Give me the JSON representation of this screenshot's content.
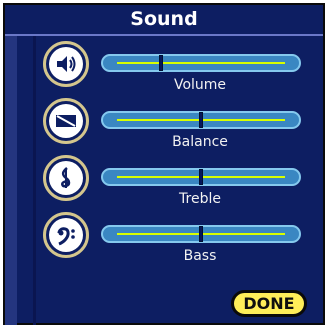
{
  "window": {
    "title": "Sound"
  },
  "controls": [
    {
      "id": "volume",
      "label": "Volume",
      "icon": "speaker-icon",
      "value": 0.26
    },
    {
      "id": "balance",
      "label": "Balance",
      "icon": "balance-icon",
      "value": 0.5
    },
    {
      "id": "treble",
      "label": "Treble",
      "icon": "treble-clef-icon",
      "value": 0.5
    },
    {
      "id": "bass",
      "label": "Bass",
      "icon": "bass-clef-icon",
      "value": 0.5
    }
  ],
  "footer": {
    "done_label": "DONE"
  },
  "colors": {
    "panel": "#0d1e62",
    "slider_fill": "#3a87c2",
    "slider_track": "#d7ff00",
    "icon_ring": "#d4c68d",
    "done_button": "#ffee59"
  }
}
